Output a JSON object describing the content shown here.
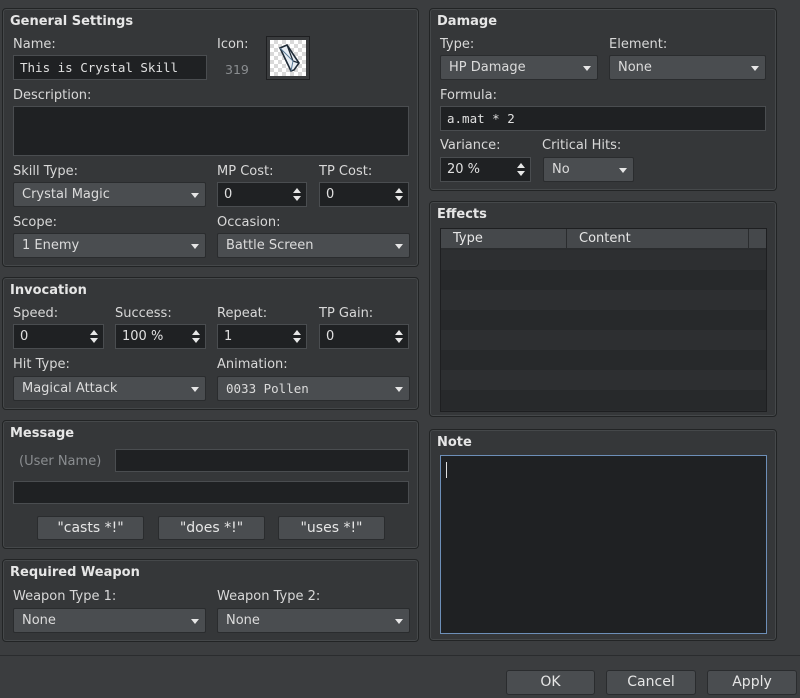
{
  "general": {
    "title": "General Settings",
    "name_label": "Name:",
    "name_value": "This is Crystal Skill",
    "icon_label": "Icon:",
    "icon_index": "319",
    "description_label": "Description:",
    "description_value": "",
    "skill_type_label": "Skill Type:",
    "skill_type_value": "Crystal Magic",
    "mp_cost_label": "MP Cost:",
    "mp_cost_value": "0",
    "tp_cost_label": "TP Cost:",
    "tp_cost_value": "0",
    "scope_label": "Scope:",
    "scope_value": "1 Enemy",
    "occasion_label": "Occasion:",
    "occasion_value": "Battle Screen"
  },
  "invocation": {
    "title": "Invocation",
    "speed_label": "Speed:",
    "speed_value": "0",
    "success_label": "Success:",
    "success_value": "100 %",
    "repeat_label": "Repeat:",
    "repeat_value": "1",
    "tp_gain_label": "TP Gain:",
    "tp_gain_value": "0",
    "hit_type_label": "Hit Type:",
    "hit_type_value": "Magical Attack",
    "animation_label": "Animation:",
    "animation_value": "0033 Pollen"
  },
  "message": {
    "title": "Message",
    "user_name_placeholder": "(User Name)",
    "casts_button": "\"casts *!\"",
    "does_button": "\"does *!\"",
    "uses_button": "\"uses *!\""
  },
  "required_weapon": {
    "title": "Required Weapon",
    "weapon_type1_label": "Weapon Type 1:",
    "weapon_type1_value": "None",
    "weapon_type2_label": "Weapon Type 2:",
    "weapon_type2_value": "None"
  },
  "damage": {
    "title": "Damage",
    "type_label": "Type:",
    "type_value": "HP Damage",
    "element_label": "Element:",
    "element_value": "None",
    "formula_label": "Formula:",
    "formula_value": "a.mat * 2",
    "variance_label": "Variance:",
    "variance_value": "20 %",
    "critical_label": "Critical Hits:",
    "critical_value": "No"
  },
  "effects": {
    "title": "Effects",
    "col_type": "Type",
    "col_content": "Content"
  },
  "note": {
    "title": "Note",
    "value": ""
  },
  "footer": {
    "ok": "OK",
    "cancel": "Cancel",
    "apply": "Apply"
  },
  "colors": {
    "background": "#3b3d3f",
    "panel": "#353739",
    "field": "#1f2123",
    "dropdown": "#4a4d50",
    "focus_border": "#6d8fb8"
  }
}
